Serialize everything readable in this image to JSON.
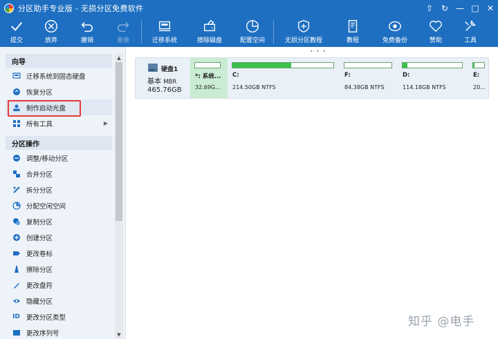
{
  "window": {
    "title": "分区助手专业版 - 无损分区免费软件",
    "controls": [
      "⇧",
      "↻",
      "—",
      "□",
      "✕"
    ]
  },
  "toolbar": {
    "buttons": [
      {
        "label": "提交",
        "icon": "check-icon"
      },
      {
        "label": "放弃",
        "icon": "cancel-icon"
      },
      {
        "label": "撤销",
        "icon": "undo-icon"
      },
      {
        "label": "重做",
        "icon": "redo-icon"
      },
      {
        "label": "迁移系统",
        "icon": "migrate-os-icon"
      },
      {
        "label": "擦除磁盘",
        "icon": "wipe-disk-icon"
      },
      {
        "label": "配置空间",
        "icon": "allocate-space-icon"
      },
      {
        "label": "无损分区教程",
        "icon": "shield-plus-icon"
      },
      {
        "label": "教程",
        "icon": "tutorial-icon"
      },
      {
        "label": "免费备份",
        "icon": "backup-icon"
      },
      {
        "label": "赞助",
        "icon": "heart-icon"
      },
      {
        "label": "工具",
        "icon": "tools-icon"
      }
    ]
  },
  "sidebar": {
    "wizard": {
      "title": "向导",
      "items": [
        {
          "label": "迁移系统到固态硬盘",
          "icon": "migrate-ssd-icon"
        },
        {
          "label": "恢复分区",
          "icon": "recover-icon"
        },
        {
          "label": "制作启动光盘",
          "icon": "bootable-disc-icon"
        },
        {
          "label": "所有工具",
          "icon": "all-tools-icon"
        }
      ]
    },
    "partition_ops": {
      "title": "分区操作",
      "items": [
        {
          "label": "调整/移动分区",
          "icon": "resize-icon"
        },
        {
          "label": "合并分区",
          "icon": "merge-icon"
        },
        {
          "label": "拆分分区",
          "icon": "split-icon"
        },
        {
          "label": "分配空闲空间",
          "icon": "allocate-free-icon"
        },
        {
          "label": "复制分区",
          "icon": "copy-icon"
        },
        {
          "label": "创建分区",
          "icon": "create-icon"
        },
        {
          "label": "更改卷标",
          "icon": "label-icon"
        },
        {
          "label": "擦除分区",
          "icon": "wipe-icon"
        },
        {
          "label": "更改盘符",
          "icon": "drive-letter-icon"
        },
        {
          "label": "隐藏分区",
          "icon": "hide-icon"
        },
        {
          "label": "更改分区类型",
          "icon": "id-text",
          "text_icon": "ID"
        },
        {
          "label": "更改序列号",
          "icon": "serial-icon"
        }
      ]
    }
  },
  "disk": {
    "name": "硬盘1",
    "type": "基本",
    "style": "MBR",
    "size": "465.76GB",
    "partitions": [
      {
        "name": "*: 系统...",
        "info": "32.69G...",
        "used": 0
      },
      {
        "name": "C:",
        "info": "214.50GB NTFS",
        "used": 0.58
      },
      {
        "name": "F:",
        "info": "84.38GB NTFS",
        "used": 0
      },
      {
        "name": "D:",
        "info": "114.18GB NTFS",
        "used": 0.08
      },
      {
        "name": "E:",
        "info": "20...",
        "used": 0.12
      }
    ]
  },
  "watermark": "知乎 @电手"
}
